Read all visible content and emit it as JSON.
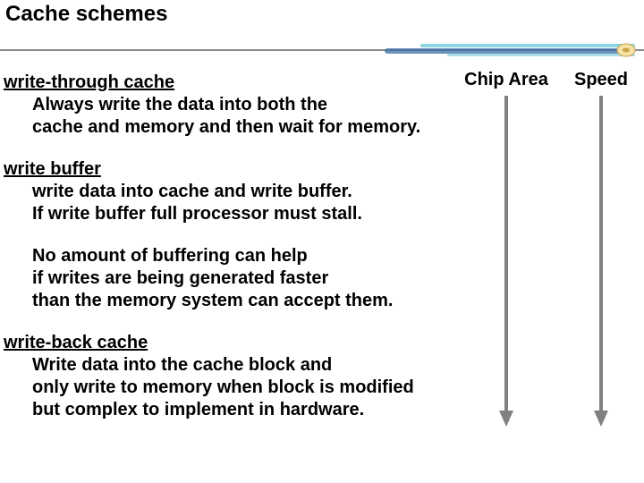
{
  "title": "Cache schemes",
  "sections": {
    "write_through": {
      "heading": "write-through cache",
      "body1": "Always write the data into both the",
      "body2": "cache and memory and then wait for memory."
    },
    "write_buffer": {
      "heading": "write buffer",
      "body1": "write data into cache and write buffer.",
      "body2": "If write buffer full processor must stall.",
      "note1": "No amount of buffering can help",
      "note2": "if writes are being generated faster",
      "note3": "than the memory system can accept them."
    },
    "write_back": {
      "heading": "write-back cache",
      "body1": "Write data into the cache block and",
      "body2": "only write to memory when block is modified",
      "body3": "but complex to implement in hardware."
    }
  },
  "arrows": {
    "chip": "Chip Area",
    "speed": "Speed"
  },
  "colors": {
    "arrow": "#808080",
    "divider_dark": "#444444",
    "divider_cyan": "#6fcad6",
    "divider_blue": "#3a6ea5",
    "bullet_gold": "#c9a24a",
    "bullet_hi": "#f5e3a6"
  }
}
